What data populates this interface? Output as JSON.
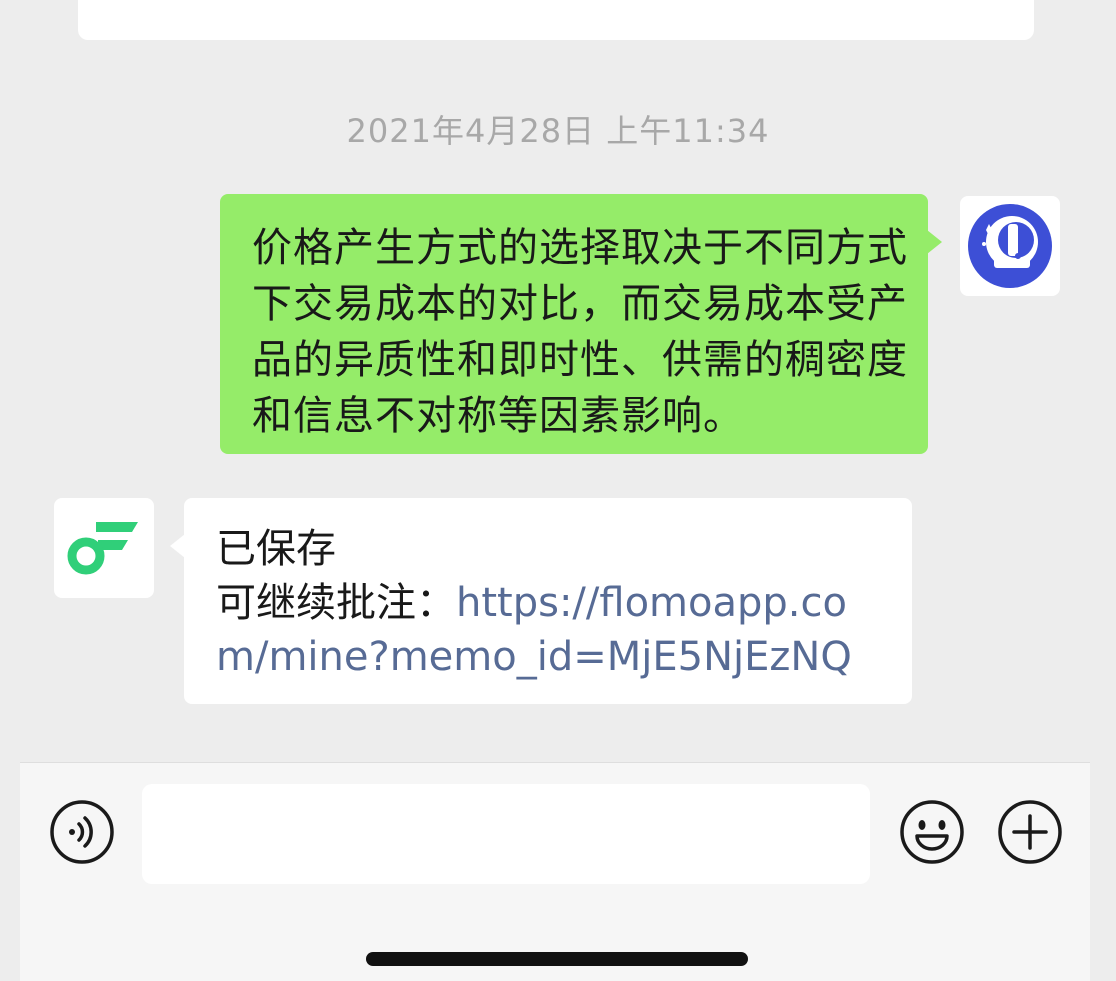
{
  "chat": {
    "timestamp": "2021年4月28日 上午11:34",
    "messages": [
      {
        "direction": "sent",
        "text": "价格产生方式的选择取决于不同方式下交易成本的对比，而交易成本受产品的异质性和即时性、供需的稠密度和信息不对称等因素影响。",
        "avatar_icon": "astronaut-avatar-icon"
      },
      {
        "direction": "received",
        "line1": "已保存",
        "line2_prefix": "可继续批注：",
        "link": "https://flomoapp.com/mine?memo_id=MjE5NjEzNQ",
        "avatar_icon": "flomo-logo-icon"
      }
    ]
  },
  "input_bar": {
    "voice_icon": "voice-icon",
    "emoji_icon": "emoji-icon",
    "plus_icon": "plus-icon",
    "input_value": ""
  },
  "colors": {
    "chat_background": "#ededed",
    "sent_bubble": "#95ec69",
    "received_bubble": "#ffffff",
    "link": "#576b95",
    "flomo_green": "#30cf79",
    "avatar_blue": "#3d4fd6"
  }
}
